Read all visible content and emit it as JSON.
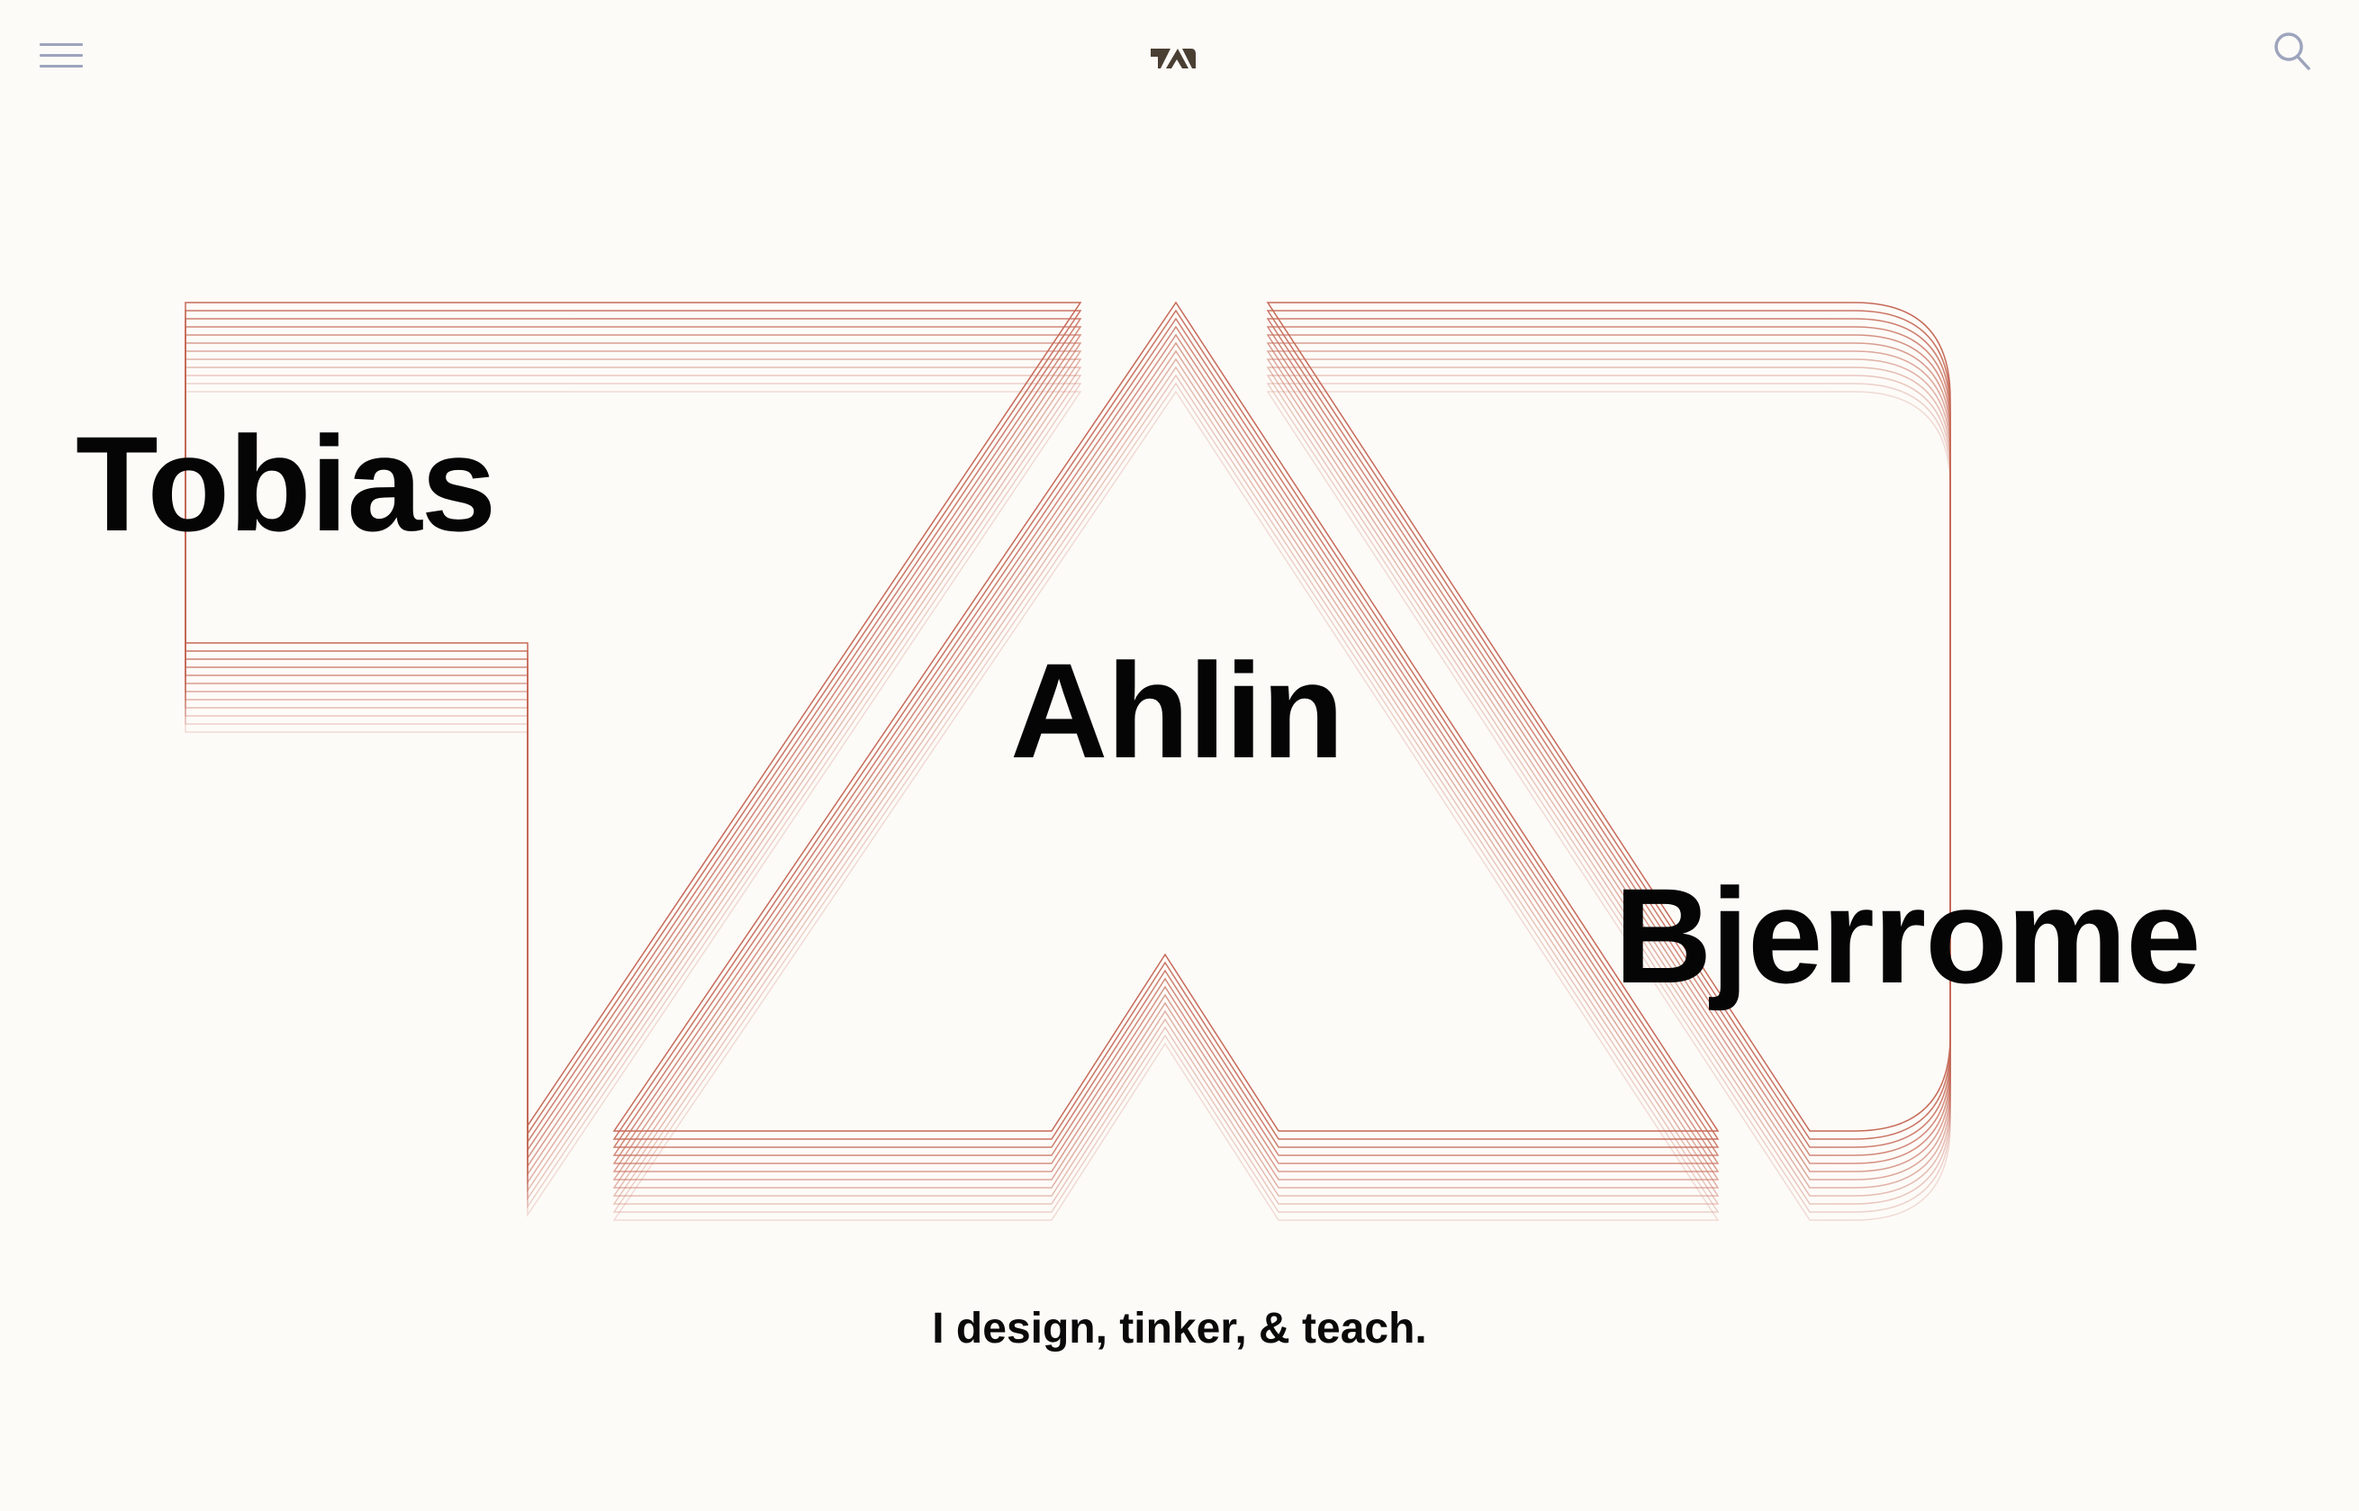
{
  "header": {
    "menu_icon": "hamburger-menu-icon",
    "logo_icon": "ta-monogram-logo",
    "search_icon": "search-icon"
  },
  "hero": {
    "name_first": "Tobias",
    "name_middle": "Ahlin",
    "name_last": "Bjerrome",
    "tagline": "I design, tinker, & teach."
  },
  "colors": {
    "background": "#fdfbf8",
    "line_accent": "#c66a58",
    "text": "#050505",
    "icon": "#9da4bd",
    "logo": "#4a3f33"
  }
}
